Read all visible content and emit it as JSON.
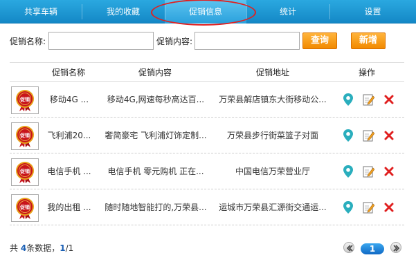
{
  "tabs": [
    {
      "label": "共享车辆"
    },
    {
      "label": "我的收藏"
    },
    {
      "label": "促销信息"
    },
    {
      "label": "统计"
    },
    {
      "label": "设置"
    }
  ],
  "active_tab": "促销信息",
  "search": {
    "name_label": "促销名称:",
    "name_value": "",
    "content_label": "促销内容:",
    "content_value": "",
    "query_button": "查询",
    "add_button": "新增"
  },
  "table": {
    "headers": {
      "name": "促销名称",
      "content": "促销内容",
      "address": "促销地址",
      "actions": "操作"
    },
    "thumb_seal_text": "促销",
    "rows": [
      {
        "name": "移动4G  ...",
        "content": "移动4G,网速每秒高达百...",
        "address": "万荣县解店镇东大街移动公..."
      },
      {
        "name": "飞利浦20...",
        "content": "奢简豪宅 飞利浦灯饰定制...",
        "address": "万荣县步行街菜篮子对面"
      },
      {
        "name": "电信手机  ...",
        "content": "电信手机 零元购机 正在...",
        "address": "中国电信万荣营业厅"
      },
      {
        "name": "我的出租  ...",
        "content": "随时随地智能打的,万荣县...",
        "address": "运城市万荣县汇源街交通运..."
      }
    ]
  },
  "footer": {
    "prefix": "共 ",
    "total": "4",
    "middle": "条数据，",
    "page": "1",
    "of_pages": "/1"
  },
  "pagination": {
    "current": "1"
  },
  "colors": {
    "tab_bar": "#1a96d4",
    "active_ring": "#e02020",
    "orange_button": "#f59a12",
    "map_pin": "#2aaebd",
    "delete_x": "#e02020",
    "link_blue": "#1a5fb4"
  },
  "icons": {
    "locate": "map-pin-icon",
    "edit": "edit-icon",
    "delete": "delete-icon"
  }
}
